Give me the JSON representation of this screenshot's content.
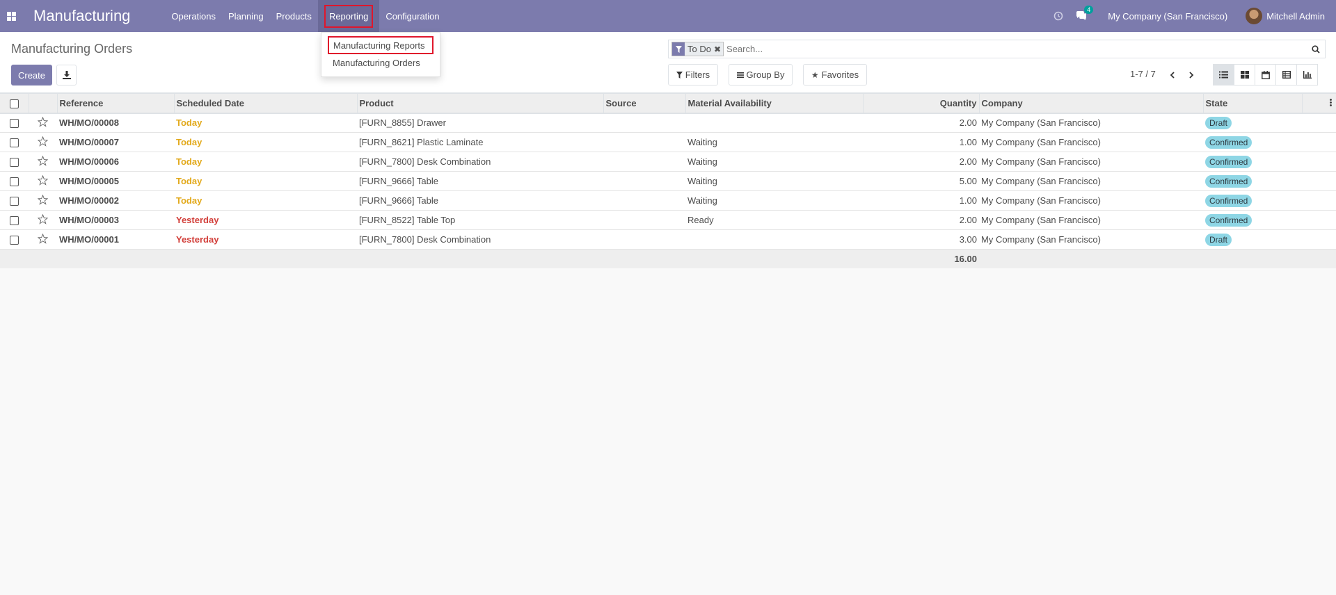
{
  "navbar": {
    "brand": "Manufacturing",
    "menu": [
      "Operations",
      "Planning",
      "Products",
      "Reporting",
      "Configuration"
    ],
    "message_count": "4",
    "company": "My Company (San Francisco)",
    "user": "Mitchell Admin"
  },
  "dropdown": {
    "items": [
      "Manufacturing Reports",
      "Manufacturing Orders"
    ]
  },
  "control_panel": {
    "title": "Manufacturing Orders",
    "create_label": "Create",
    "facet_label": "To Do",
    "search_placeholder": "Search...",
    "filters_label": "Filters",
    "groupby_label": "Group By",
    "favorites_label": "Favorites",
    "pager": "1-7 / 7"
  },
  "table": {
    "headers": [
      "Reference",
      "Scheduled Date",
      "Product",
      "Source",
      "Material Availability",
      "Quantity",
      "Company",
      "State"
    ],
    "rows": [
      {
        "ref": "WH/MO/00008",
        "date": "Today",
        "date_kind": "today",
        "product": "[FURN_8855] Drawer",
        "source": "",
        "availability": "",
        "qty": "2.00",
        "company": "My Company (San Francisco)",
        "state": "Draft"
      },
      {
        "ref": "WH/MO/00007",
        "date": "Today",
        "date_kind": "today",
        "product": "[FURN_8621] Plastic Laminate",
        "source": "",
        "availability": "Waiting",
        "qty": "1.00",
        "company": "My Company (San Francisco)",
        "state": "Confirmed"
      },
      {
        "ref": "WH/MO/00006",
        "date": "Today",
        "date_kind": "today",
        "product": "[FURN_7800] Desk Combination",
        "source": "",
        "availability": "Waiting",
        "qty": "2.00",
        "company": "My Company (San Francisco)",
        "state": "Confirmed"
      },
      {
        "ref": "WH/MO/00005",
        "date": "Today",
        "date_kind": "today",
        "product": "[FURN_9666] Table",
        "source": "",
        "availability": "Waiting",
        "qty": "5.00",
        "company": "My Company (San Francisco)",
        "state": "Confirmed"
      },
      {
        "ref": "WH/MO/00002",
        "date": "Today",
        "date_kind": "today",
        "product": "[FURN_9666] Table",
        "source": "",
        "availability": "Waiting",
        "qty": "1.00",
        "company": "My Company (San Francisco)",
        "state": "Confirmed"
      },
      {
        "ref": "WH/MO/00003",
        "date": "Yesterday",
        "date_kind": "yesterday",
        "product": "[FURN_8522] Table Top",
        "source": "",
        "availability": "Ready",
        "qty": "2.00",
        "company": "My Company (San Francisco)",
        "state": "Confirmed"
      },
      {
        "ref": "WH/MO/00001",
        "date": "Yesterday",
        "date_kind": "yesterday",
        "product": "[FURN_7800] Desk Combination",
        "source": "",
        "availability": "",
        "qty": "3.00",
        "company": "My Company (San Francisco)",
        "state": "Draft"
      }
    ],
    "total_qty": "16.00"
  },
  "colors": {
    "brand": "#7c7bad",
    "today": "#e2a91b",
    "yesterday": "#d23f3a",
    "state_badge": "#8ed6e5"
  }
}
